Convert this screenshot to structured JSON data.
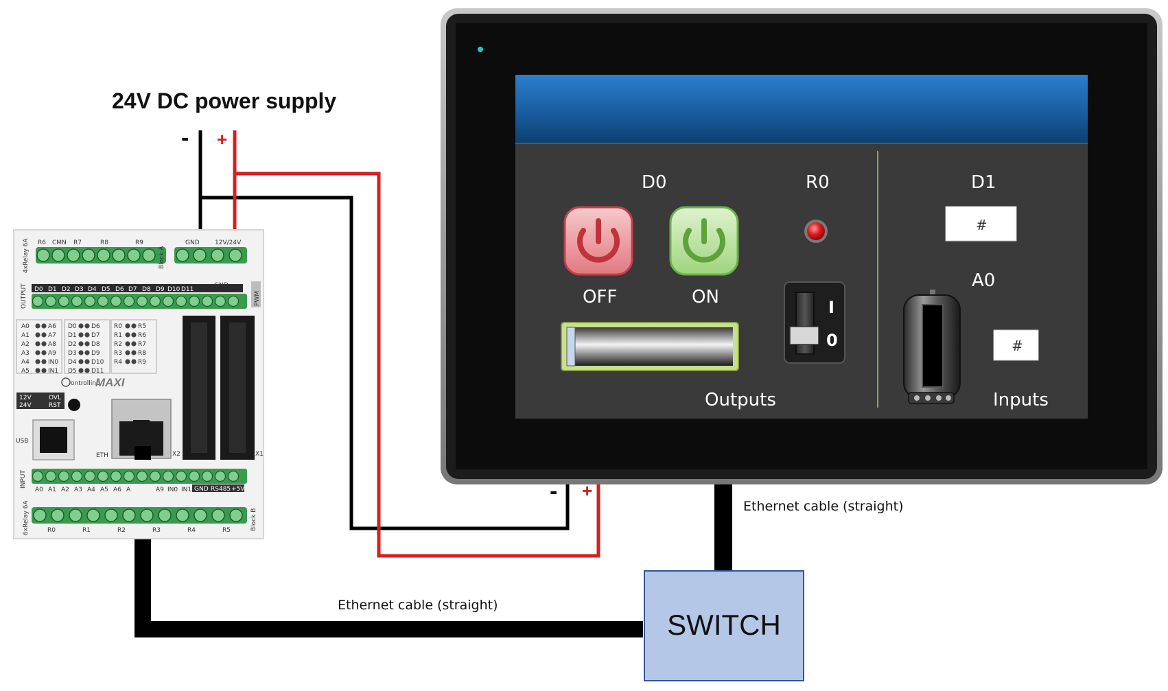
{
  "power_supply": {
    "title": "24V DC power supply",
    "minus": "-",
    "plus": "+"
  },
  "plc": {
    "brand": "MAXI",
    "logo_text": "ontrollino",
    "top_labels": [
      "R6",
      "CMN",
      "R7",
      "R8",
      "R9",
      "GND",
      "12V/24V"
    ],
    "side_label_relay_top": "4xRelay 6A",
    "block_a": "Block A",
    "output_side": "OUTPUT",
    "output_labels": [
      "D0",
      "D1",
      "D2",
      "D3",
      "D4",
      "D5",
      "D6",
      "D7",
      "D8",
      "D9",
      "D10",
      "D11"
    ],
    "output_gnd": "GND",
    "pwm": "PWM",
    "led_col1": [
      "A0",
      "A1",
      "A2",
      "A3",
      "A4",
      "A5"
    ],
    "led_col1b": [
      "A6",
      "A7",
      "A8",
      "A9",
      "IN0",
      "IN1"
    ],
    "led_col2": [
      "D0",
      "D1",
      "D2",
      "D3",
      "D4",
      "D5"
    ],
    "led_col2b": [
      "D6",
      "D7",
      "D8",
      "D9",
      "D10",
      "D11"
    ],
    "led_col3": [
      "R0",
      "R1",
      "R2",
      "R3",
      "R4"
    ],
    "led_col3b": [
      "R5",
      "R6",
      "R7",
      "R8",
      "R9"
    ],
    "v12": "12V",
    "v24": "24V",
    "ovl": "OVL",
    "rst": "RST",
    "usb": "USB",
    "eth": "ETH",
    "x2": "X2",
    "x1": "X1",
    "input_side": "INPUT",
    "input_labels": [
      "A0",
      "A1",
      "A2",
      "A3",
      "A4",
      "A5",
      "A6",
      "A",
      "A9",
      "IN0",
      "IN1"
    ],
    "input_gnd": "GND",
    "rs485": "RS485",
    "plus5v": "+5V",
    "side_label_relay_bottom": "6xRelay 6A",
    "block_b": "Block B",
    "bottom_labels": [
      "R0",
      "R1",
      "R2",
      "R3",
      "R4",
      "R5"
    ]
  },
  "hmi": {
    "d0": "D0",
    "r0": "R0",
    "d1": "D1",
    "a0": "A0",
    "off": "OFF",
    "on": "ON",
    "d1_value": "#",
    "a0_value": "#",
    "switch_on": "I",
    "switch_off": "0",
    "outputs": "Outputs",
    "inputs": "Inputs",
    "slider_value": 0.0,
    "power_minus": "-",
    "power_plus": "+"
  },
  "switch": {
    "label": "SWITCH"
  },
  "cables": {
    "hmi_cable": "Ethernet cable (straight)",
    "plc_cable": "Ethernet cable (straight)"
  },
  "colors": {
    "wire_red": "#d61f1f",
    "wire_black": "#000000",
    "switch_fill": "#b4c7e7",
    "switch_border": "#2f5597",
    "terminal_green": "#3a9a50",
    "hmi_header": "#1f6fb8",
    "hmi_panel": "#3a3a3a"
  }
}
